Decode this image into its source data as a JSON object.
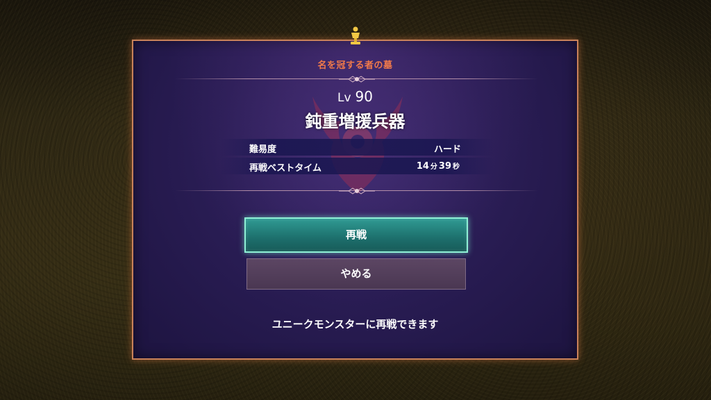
{
  "dialog": {
    "location": "名を冠する者の墓",
    "level_prefix": "Lv",
    "level_value": "90",
    "boss_name": "鈍重増援兵器",
    "info_rows": [
      {
        "label": "難易度",
        "value": "ハード"
      },
      {
        "label": "再戦ベストタイム",
        "minutes": "14",
        "minutes_unit": "分",
        "seconds": "39",
        "seconds_unit": "秒"
      }
    ],
    "buttons": {
      "retry_label": "再戦",
      "quit_label": "やめる"
    },
    "hint": "ユニークモンスターに再戦できます"
  },
  "colors": {
    "frame_border": "#c9825a",
    "location_text": "#f07a4a",
    "retry_button": "#1d6f6c",
    "retry_border": "#8ff0d6",
    "quit_button": "#4a3752",
    "trophy": "#f2c744"
  },
  "icons": {
    "trophy": "trophy-icon",
    "emblem": "monster-emblem-icon"
  }
}
